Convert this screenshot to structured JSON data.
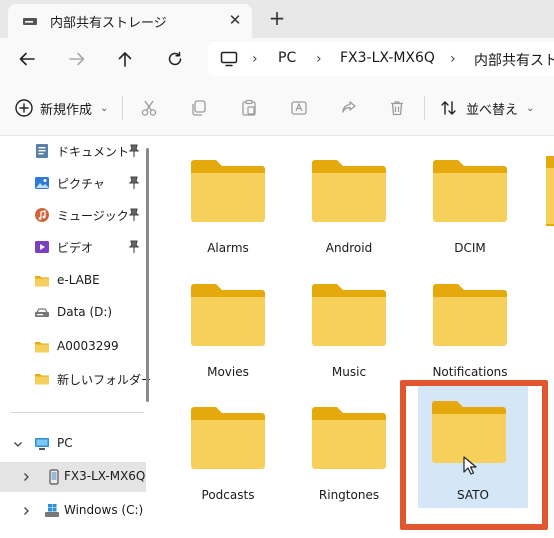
{
  "window": {
    "tab_title": "内部共有ストレージ",
    "close_glyph": "✕",
    "new_tab_glyph": "+"
  },
  "address_bar": {
    "crumbs": [
      "PC",
      "FX3-LX-MX6Q",
      "内部共有スト"
    ],
    "separator": "›"
  },
  "command_bar": {
    "new_label": "新規作成",
    "sort_label": "並べ替え",
    "chevron": "⌄"
  },
  "sidebar": {
    "quick_access": [
      {
        "label": "ドキュメント",
        "icon": "documents-icon",
        "pinned": true
      },
      {
        "label": "ピクチャ",
        "icon": "pictures-icon",
        "pinned": true
      },
      {
        "label": "ミュージック",
        "icon": "music-icon",
        "pinned": true
      },
      {
        "label": "ビデオ",
        "icon": "videos-icon",
        "pinned": true
      },
      {
        "label": "e-LABE",
        "icon": "folder-icon",
        "pinned": false
      },
      {
        "label": "Data (D:)",
        "icon": "drive-icon",
        "pinned": false
      },
      {
        "label": "A0003299",
        "icon": "folder-icon",
        "pinned": false
      },
      {
        "label": "新しいフォルダー",
        "icon": "folder-icon",
        "pinned": false
      }
    ],
    "tree": [
      {
        "label": "PC",
        "icon": "pc-icon",
        "expanded": true
      },
      {
        "label": "FX3-LX-MX6Q",
        "icon": "device-icon",
        "selected": true
      },
      {
        "label": "Windows (C:)",
        "icon": "windows-drive-icon"
      }
    ]
  },
  "content": {
    "folders": [
      "Alarms",
      "Android",
      "DCIM",
      "Movies",
      "Music",
      "Notifications",
      "Podcasts",
      "Ringtones",
      "SATO"
    ],
    "selected_folder": "SATO"
  },
  "colors": {
    "folder_back": "#e5a90e",
    "folder_front": "#f7cf5b",
    "selection": "#d4e6f8",
    "highlight_box": "#e0572e"
  }
}
